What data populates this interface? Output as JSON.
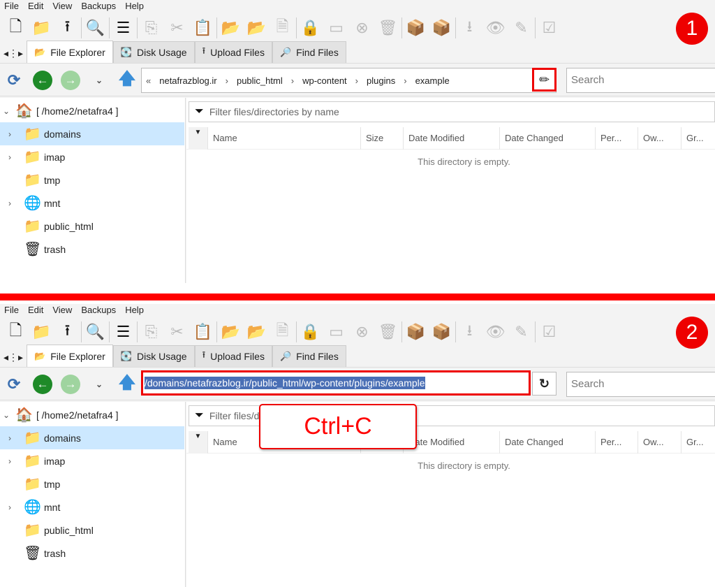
{
  "menu": [
    "File",
    "Edit",
    "View",
    "Backups",
    "Help"
  ],
  "toolbar": [
    {
      "icon": "new-file-icon",
      "glyph": "🗋",
      "on": true
    },
    {
      "icon": "new-folder-icon",
      "glyph": "📁",
      "on": true
    },
    {
      "icon": "upload-icon",
      "glyph": "⭱",
      "on": true,
      "sep": true
    },
    {
      "icon": "search-icon",
      "glyph": "🔍",
      "on": false,
      "sep": true
    },
    {
      "icon": "select-all-icon",
      "glyph": "☰",
      "on": true,
      "sep": true
    },
    {
      "icon": "copy-icon",
      "glyph": "⎘",
      "on": false
    },
    {
      "icon": "cut-icon",
      "glyph": "✂",
      "on": false
    },
    {
      "icon": "paste-icon",
      "glyph": "📋",
      "on": false,
      "sep": true
    },
    {
      "icon": "move-icon",
      "glyph": "📂",
      "on": false
    },
    {
      "icon": "copy-to-icon",
      "glyph": "📂",
      "on": false
    },
    {
      "icon": "rename-file-icon",
      "glyph": "🗎",
      "on": false,
      "sep": true
    },
    {
      "icon": "permissions-icon",
      "glyph": "🔒",
      "on": false
    },
    {
      "icon": "rename-icon",
      "glyph": "▭",
      "on": false
    },
    {
      "icon": "delete-icon",
      "glyph": "⊗",
      "on": false
    },
    {
      "icon": "trash-icon",
      "glyph": "🗑",
      "on": false,
      "sep": true
    },
    {
      "icon": "compress-icon",
      "glyph": "📦",
      "on": false
    },
    {
      "icon": "extract-icon",
      "glyph": "📦",
      "on": false,
      "sep": true
    },
    {
      "icon": "download-icon",
      "glyph": "⭳",
      "on": false
    },
    {
      "icon": "view-icon",
      "glyph": "👁",
      "on": false
    },
    {
      "icon": "edit-icon",
      "glyph": "✎",
      "on": false,
      "sep": true
    },
    {
      "icon": "checklist-icon",
      "glyph": "☑",
      "on": false
    }
  ],
  "tabs": [
    {
      "label": "File Explorer",
      "icon": "folder-open-icon",
      "glyph": "📂",
      "active": true
    },
    {
      "label": "Disk Usage",
      "icon": "disk-icon",
      "glyph": "💽"
    },
    {
      "label": "Upload Files",
      "icon": "upload-icon",
      "glyph": "⭱"
    },
    {
      "label": "Find Files",
      "icon": "find-files-icon",
      "glyph": "🔎"
    }
  ],
  "breadcrumb": {
    "overflow": "«",
    "items": [
      "netafrazblog.ir",
      "public_html",
      "wp-content",
      "plugins",
      "example"
    ]
  },
  "path_text": "/domains/netafrazblog.ir/public_html/wp-content/plugins/example",
  "search_placeholder": "Search",
  "tree": {
    "root": "[ /home2/netafra4 ]",
    "items": [
      {
        "label": "domains",
        "icon": "folder-icon",
        "expandable": true,
        "selected": true
      },
      {
        "label": "imap",
        "icon": "folder-icon",
        "expandable": true
      },
      {
        "label": "tmp",
        "icon": "folder-icon",
        "expandable": false
      },
      {
        "label": "mnt",
        "icon": "globe-folder-icon",
        "expandable": true
      },
      {
        "label": "public_html",
        "icon": "shortcut-folder-icon",
        "expandable": false
      },
      {
        "label": "trash",
        "icon": "trash-icon",
        "expandable": false
      }
    ]
  },
  "filter_placeholder": "Filter files/directories by name",
  "columns": [
    "Name",
    "Size",
    "Date Modified",
    "Date Changed",
    "Per...",
    "Ow...",
    "Gr..."
  ],
  "empty_message": "This directory is empty.",
  "panels": [
    {
      "step": "1",
      "mode": "breadcrumb"
    },
    {
      "step": "2",
      "mode": "edit",
      "callout": "Ctrl+C"
    }
  ],
  "colors": {
    "highlight": "#ff0000",
    "selection": "#cce8ff",
    "text_selection": "#4a6fb5"
  }
}
